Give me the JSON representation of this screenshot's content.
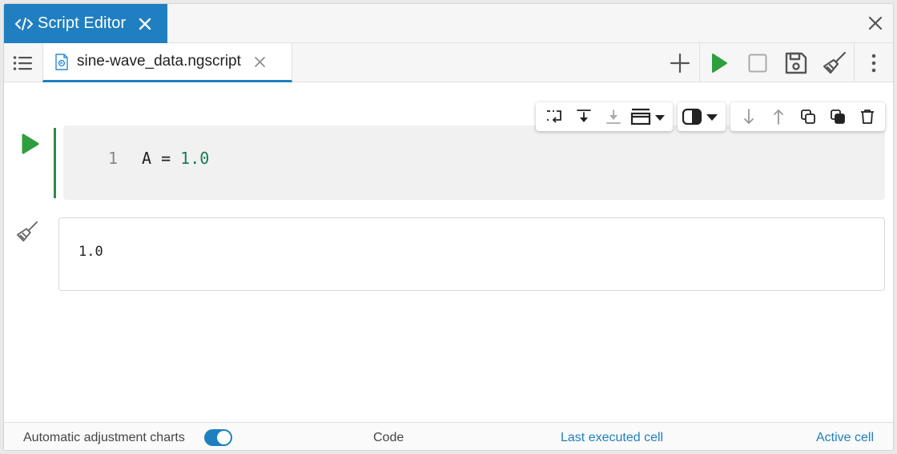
{
  "window": {
    "title": "Script Editor"
  },
  "file_tab": {
    "name": "sine-wave_data.ngscript"
  },
  "toolbar": {
    "buttons": [
      "add-icon",
      "run-icon",
      "stop-icon",
      "save-icon",
      "broom-icon",
      "more-vertical-icon"
    ]
  },
  "cell_toolbar": {
    "groups": [
      [
        "wrap-icon",
        "insert-below-icon",
        "insert-below-disabled-icon",
        "cell-layout-icon"
      ],
      [
        "contrast-icon"
      ],
      [
        "move-down-icon",
        "move-up-icon",
        "copy-icon",
        "duplicate-icon",
        "delete-icon"
      ]
    ]
  },
  "code_cell": {
    "line_number": "1",
    "code_var": "A",
    "code_op": " = ",
    "code_num": "1.0"
  },
  "output": {
    "text": "1.0"
  },
  "statusbar": {
    "auto_adjust_label": "Automatic adjustment charts",
    "auto_adjust_on": true,
    "mode": "Code",
    "last_executed": "Last executed cell",
    "active_cell": "Active cell"
  },
  "colors": {
    "accent": "#1f7fc0",
    "run_green": "#2e9e3e",
    "code_number": "#137f52"
  }
}
